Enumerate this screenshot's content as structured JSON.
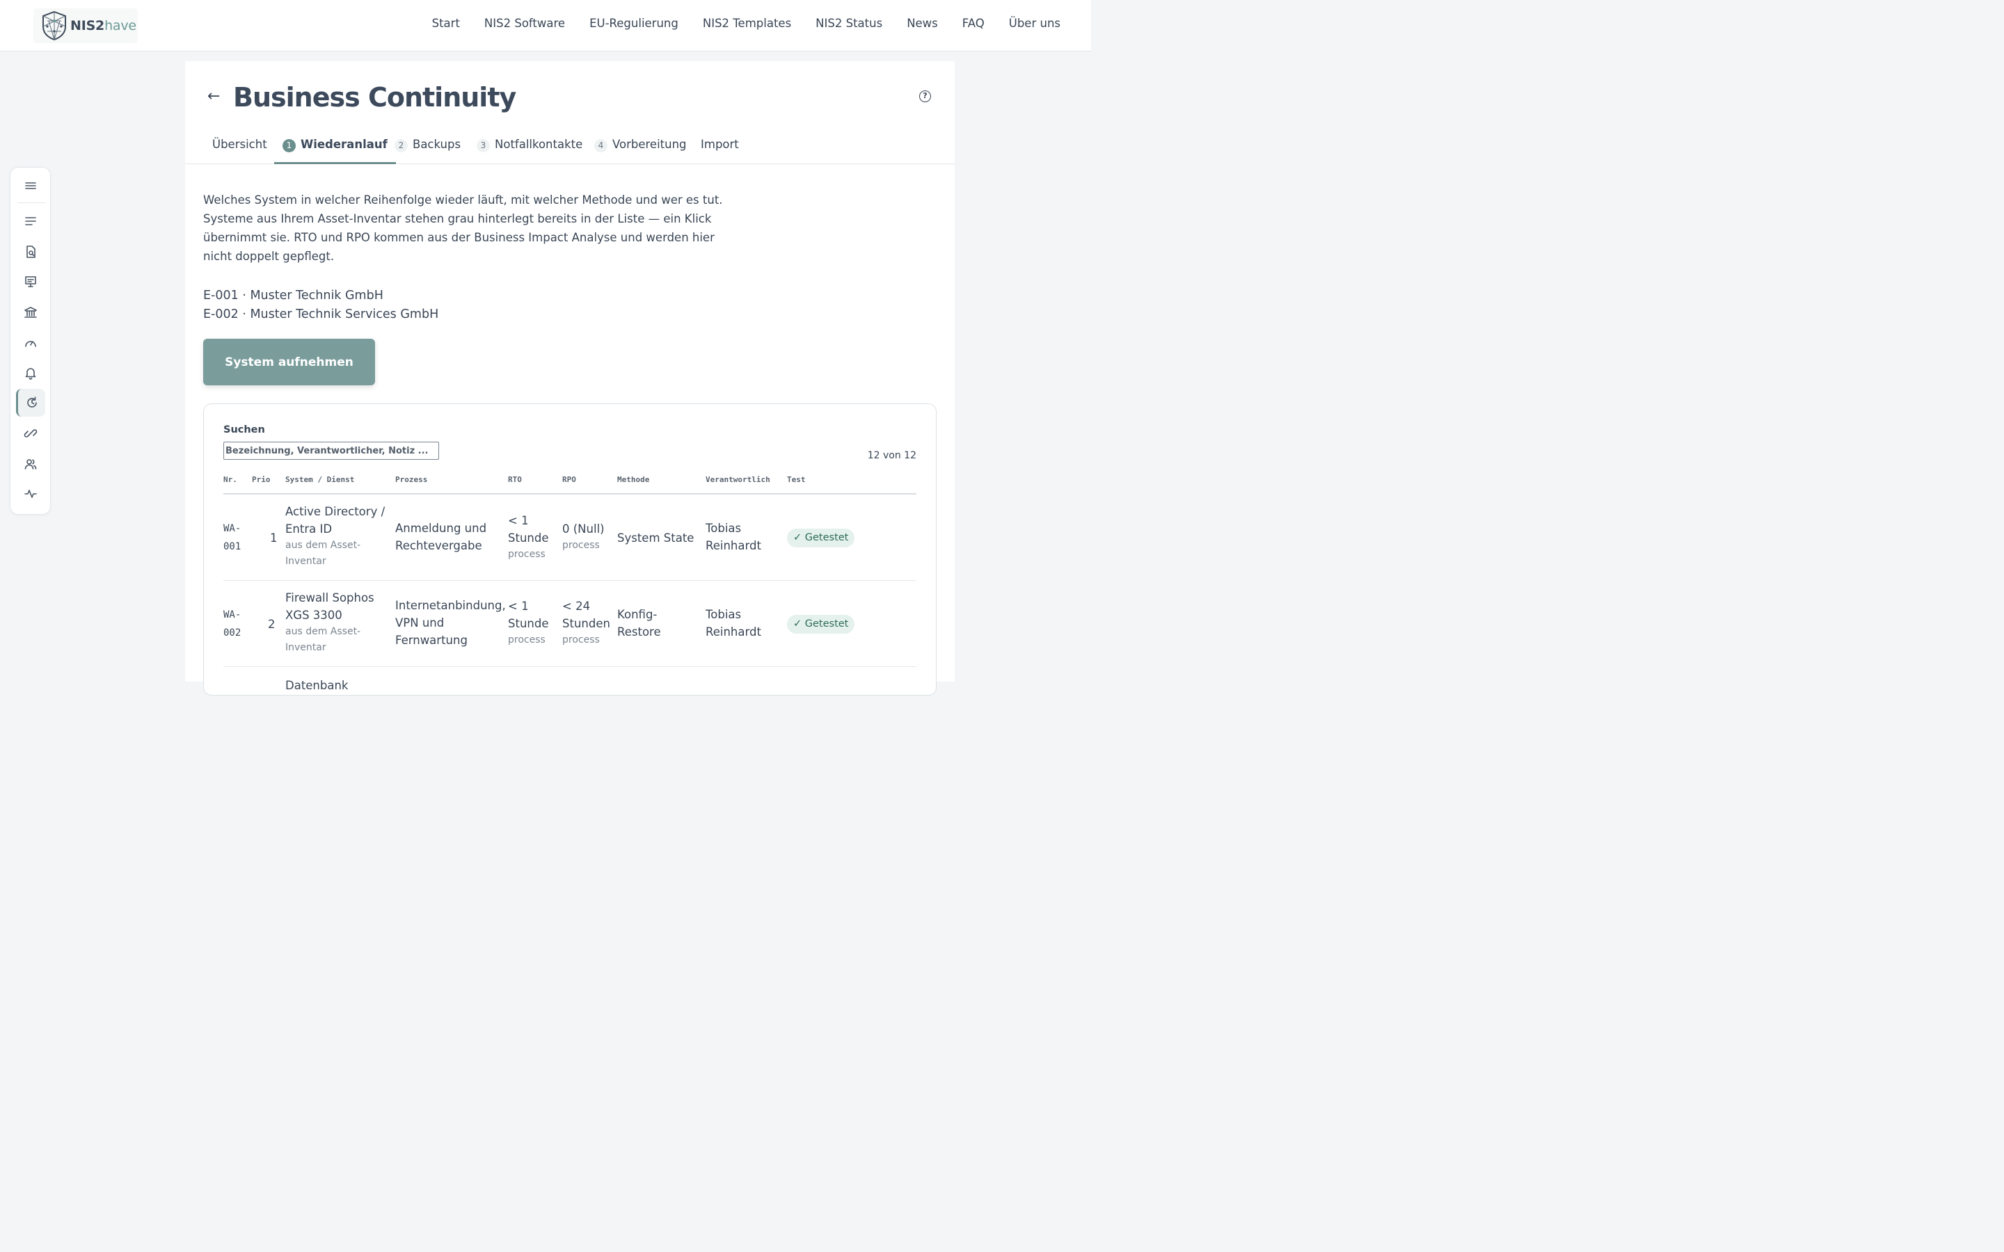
{
  "brand": {
    "name_bold": "NIS2",
    "name_light": "have"
  },
  "nav": [
    "Start",
    "NIS2 Software",
    "EU-Regulierung",
    "NIS2 Templates",
    "NIS2 Status",
    "News",
    "FAQ",
    "Über uns"
  ],
  "sidebar": {
    "items": [
      "menu-icon",
      "list-icon",
      "document-search-icon",
      "presentation-icon",
      "institution-icon",
      "gauge-icon",
      "bell-icon",
      "restore-icon",
      "link-icon",
      "users-icon",
      "activity-icon"
    ],
    "active": "restore-icon"
  },
  "page": {
    "back": "←",
    "title": "Business Continuity",
    "help": "?",
    "tabs": [
      {
        "num": "",
        "label": "Übersicht"
      },
      {
        "num": "1",
        "label": "Wiederanlauf"
      },
      {
        "num": "2",
        "label": "Backups"
      },
      {
        "num": "3",
        "label": "Notfallkontakte"
      },
      {
        "num": "4",
        "label": "Vorbereitung"
      },
      {
        "num": "",
        "label": "Import"
      }
    ],
    "description": "Welches System in welcher Reihenfolge wieder läuft, mit welcher Methode und wer es tut. Systeme aus Ihrem Asset-Inventar stehen grau hinterlegt bereits in der Liste — ein Klick übernimmt sie. RTO und RPO kommen aus der Business Impact Analyse und werden hier nicht doppelt gepflegt.",
    "entities": [
      "E-001 · Muster Technik GmbH",
      "E-002 · Muster Technik Services GmbH"
    ],
    "add_button": "System aufnehmen"
  },
  "table": {
    "search_label": "Suchen",
    "search_placeholder": "Bezeichnung, Verantwortlicher, Notiz ...",
    "count": "12 von 12",
    "columns": [
      "Nr.",
      "Prio",
      "System / Dienst",
      "Prozess",
      "RTO",
      "RPO",
      "Methode",
      "Verantwortlich",
      "Test"
    ],
    "rows": [
      {
        "nr": "WA-001",
        "prio": "1",
        "system": "Active Directory / Entra ID",
        "system_source": "aus dem Asset-Inventar",
        "prozess": "Anmeldung und Rechtevergabe",
        "rto": "< 1 Stunde",
        "rto_src": "process",
        "rpo": "0 (Null)",
        "rpo_src": "process",
        "methode": "System State",
        "verantwortlich": "Tobias Reinhardt",
        "test": "✓ Getestet"
      },
      {
        "nr": "WA-002",
        "prio": "2",
        "system": "Firewall Sophos XGS 3300",
        "system_source": "aus dem Asset-Inventar",
        "prozess": "Internetanbindung, VPN und Fernwartung",
        "rto": "< 1 Stunde",
        "rto_src": "process",
        "rpo": "< 24 Stunden",
        "rpo_src": "process",
        "methode": "Konfig-Restore",
        "verantwortlich": "Tobias Reinhardt",
        "test": "✓ Getestet"
      }
    ],
    "next_row_partial": "Datenbank"
  },
  "colors": {
    "accent": "#6b8f8d",
    "button": "#7a9c9b",
    "badge_bg": "#e4f1ec",
    "badge_text": "#2d6b58"
  }
}
